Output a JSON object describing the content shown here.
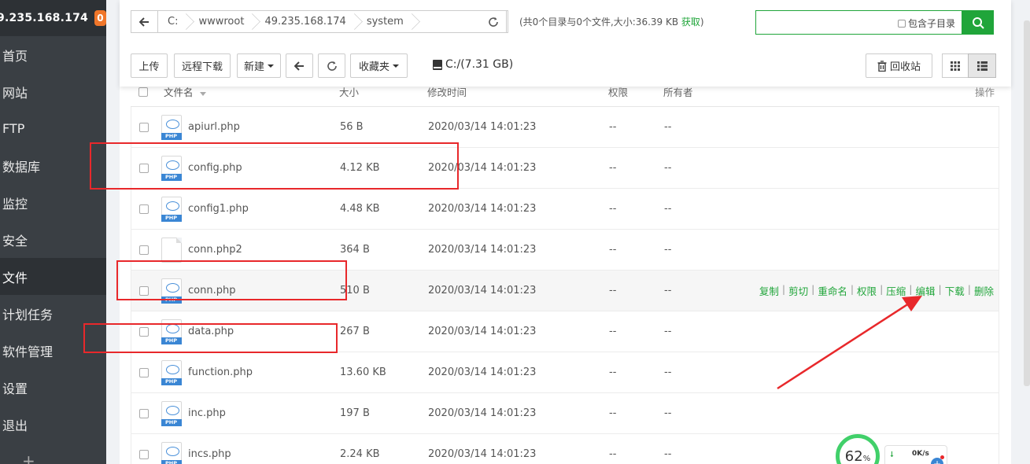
{
  "sidebar": {
    "ip": "9.235.168.174",
    "badge": "0",
    "items": [
      {
        "label": "首页"
      },
      {
        "label": "网站"
      },
      {
        "label": "FTP"
      },
      {
        "label": "数据库"
      },
      {
        "label": "监控"
      },
      {
        "label": "安全"
      },
      {
        "label": "文件"
      },
      {
        "label": "计划任务"
      },
      {
        "label": "软件管理"
      },
      {
        "label": "设置"
      },
      {
        "label": "退出"
      }
    ],
    "active_index": 6,
    "add_label": "+"
  },
  "breadcrumb": {
    "segments": [
      "C:",
      "wwwroot",
      "49.235.168.174",
      "system"
    ]
  },
  "dir_info": {
    "text": "(共0个目录与0个文件,大小:36.39 KB ",
    "get_label": "获取",
    "close": ")"
  },
  "search": {
    "value": "",
    "subdir_label": "包含子目录"
  },
  "toolbar": {
    "upload": "上传",
    "remote_download": "远程下载",
    "new": "新建",
    "favorites": "收藏夹",
    "disk": "C:/(7.31 GB)",
    "recycle": "回收站"
  },
  "table": {
    "headers": {
      "name": "文件名",
      "size": "大小",
      "mtime": "修改时间",
      "perm": "权限",
      "owner": "所有者",
      "ops": "操作"
    },
    "rows": [
      {
        "name": "apiurl.php",
        "size": "56 B",
        "mtime": "2020/03/14 14:01:23",
        "perm": "--",
        "owner": "--",
        "icon": "php"
      },
      {
        "name": "config.php",
        "size": "4.12 KB",
        "mtime": "2020/03/14 14:01:23",
        "perm": "--",
        "owner": "--",
        "icon": "php"
      },
      {
        "name": "config1.php",
        "size": "4.48 KB",
        "mtime": "2020/03/14 14:01:23",
        "perm": "--",
        "owner": "--",
        "icon": "php"
      },
      {
        "name": "conn.php2",
        "size": "364 B",
        "mtime": "2020/03/14 14:01:23",
        "perm": "--",
        "owner": "--",
        "icon": "plain"
      },
      {
        "name": "conn.php",
        "size": "510 B",
        "mtime": "2020/03/14 14:01:23",
        "perm": "--",
        "owner": "--",
        "icon": "php"
      },
      {
        "name": "data.php",
        "size": "267 B",
        "mtime": "2020/03/14 14:01:23",
        "perm": "--",
        "owner": "--",
        "icon": "php"
      },
      {
        "name": "function.php",
        "size": "13.60 KB",
        "mtime": "2020/03/14 14:01:23",
        "perm": "--",
        "owner": "--",
        "icon": "php"
      },
      {
        "name": "inc.php",
        "size": "197 B",
        "mtime": "2020/03/14 14:01:23",
        "perm": "--",
        "owner": "--",
        "icon": "php"
      },
      {
        "name": "incs.php",
        "size": "2.24 KB",
        "mtime": "2020/03/14 14:01:23",
        "perm": "--",
        "owner": "--",
        "icon": "php"
      }
    ],
    "hover_row_index": 4,
    "row_actions": [
      "复制",
      "剪切",
      "重命名",
      "权限",
      "压缩",
      "编辑",
      "下载",
      "删除"
    ],
    "icon_label": "PHP"
  },
  "widget": {
    "percent": "62",
    "percent_unit": "%",
    "speed": "0K/s"
  },
  "colors": {
    "accent": "#20a53a",
    "sidebar_bg": "#3a3f44",
    "annotation_red": "#e8282b",
    "badge": "#f0762a"
  }
}
